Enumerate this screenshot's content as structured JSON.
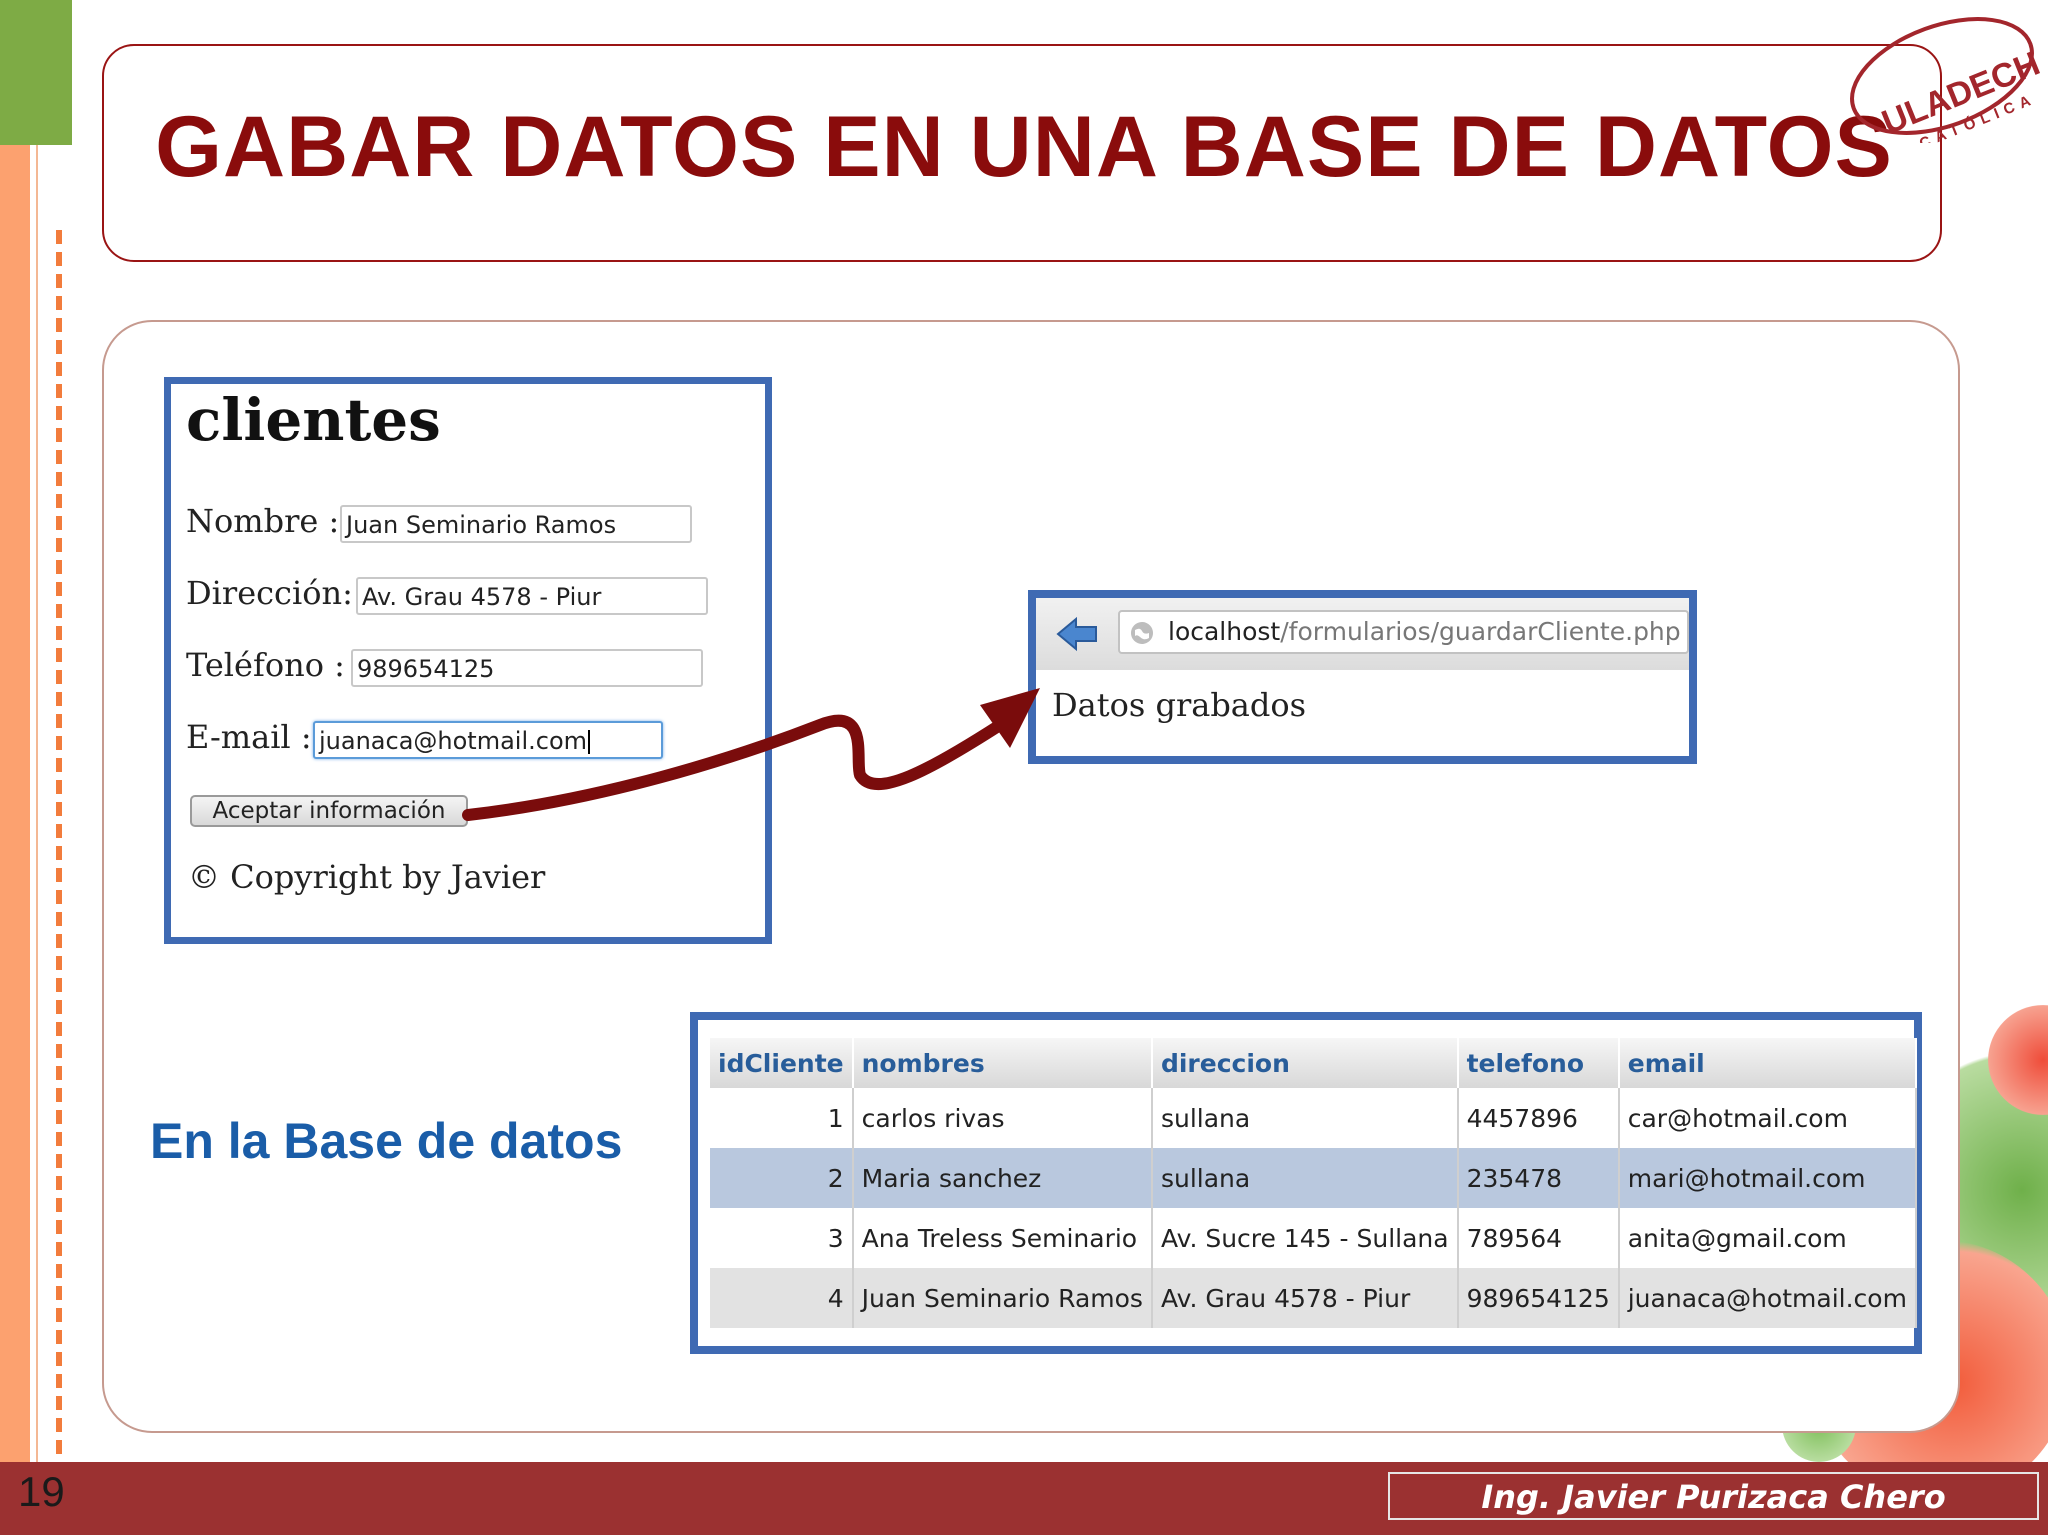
{
  "slide": {
    "title": "GABAR DATOS EN UNA BASE DE DATOS",
    "logo_text_top": "ULADECH",
    "logo_text_bottom": "CATÓLICA",
    "page_number": "19",
    "author": "Ing. Javier Purizaca Chero"
  },
  "form": {
    "heading": "clientes",
    "nombre_label": "Nombre :",
    "nombre_value": "Juan Seminario Ramos",
    "direccion_label": "Dirección:",
    "direccion_value": "Av. Grau 4578 - Piur",
    "telefono_label": "Teléfono :",
    "telefono_value": "989654125",
    "email_label": "E-mail :",
    "email_value": "juanaca@hotmail.com",
    "submit_label": "Aceptar información",
    "copyright": "© Copyright by Javier"
  },
  "browser": {
    "url_host": "localhost",
    "url_path": "/formularios/guardarCliente.php",
    "body_text": "Datos grabados",
    "back_icon": "back-arrow-icon",
    "site_icon": "globe-icon"
  },
  "database": {
    "label": "En la Base de datos",
    "columns": [
      "idCliente",
      "nombres",
      "direccion",
      "telefono",
      "email"
    ],
    "rows": [
      [
        "1",
        "carlos rivas",
        "sullana",
        "4457896",
        "car@hotmail.com"
      ],
      [
        "2",
        "Maria sanchez",
        "sullana",
        "235478",
        "mari@hotmail.com"
      ],
      [
        "3",
        "Ana Treless Seminario",
        "Av. Sucre 145 - Sullana",
        "789564",
        "anita@gmail.com"
      ],
      [
        "4",
        "Juan Seminario Ramos",
        "Av. Grau 4578 - Piur",
        "989654125",
        "juanaca@hotmail.com"
      ]
    ]
  },
  "colors": {
    "title": "#8a0c0c",
    "panel_border": "#3f6ab3",
    "arrow": "#7a0c0c",
    "db_label": "#1a5da8",
    "footer": "#9b3131"
  }
}
